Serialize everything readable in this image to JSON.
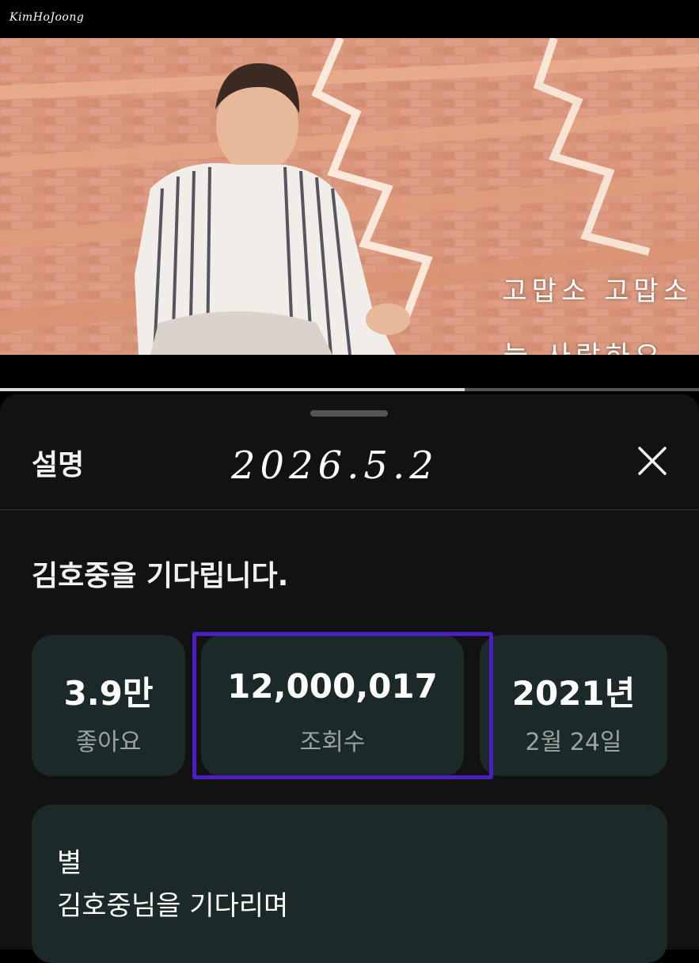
{
  "video": {
    "watermark": "KimHoJoong",
    "overlay_line1": "고맙소 고맙소",
    "overlay_line2": "늘 사랑하오",
    "progress": 0.665
  },
  "sheet": {
    "title": "설명",
    "handwritten_date": "2026.5.2",
    "close_icon": "close-icon"
  },
  "description": {
    "video_title": "김호중을 기다립니다.",
    "stats": {
      "likes_value": "3.9만",
      "likes_label": "좋아요",
      "views_value": "12,000,017",
      "views_label": "조회수",
      "date_value": "2021년",
      "date_label": "2월 24일"
    },
    "text_line1": "별",
    "text_line2": "김호중님을 기다리며"
  },
  "colors": {
    "sheet_bg": "#121212",
    "card_bg": "#1b2a28",
    "highlight": "#4b1fc4"
  }
}
